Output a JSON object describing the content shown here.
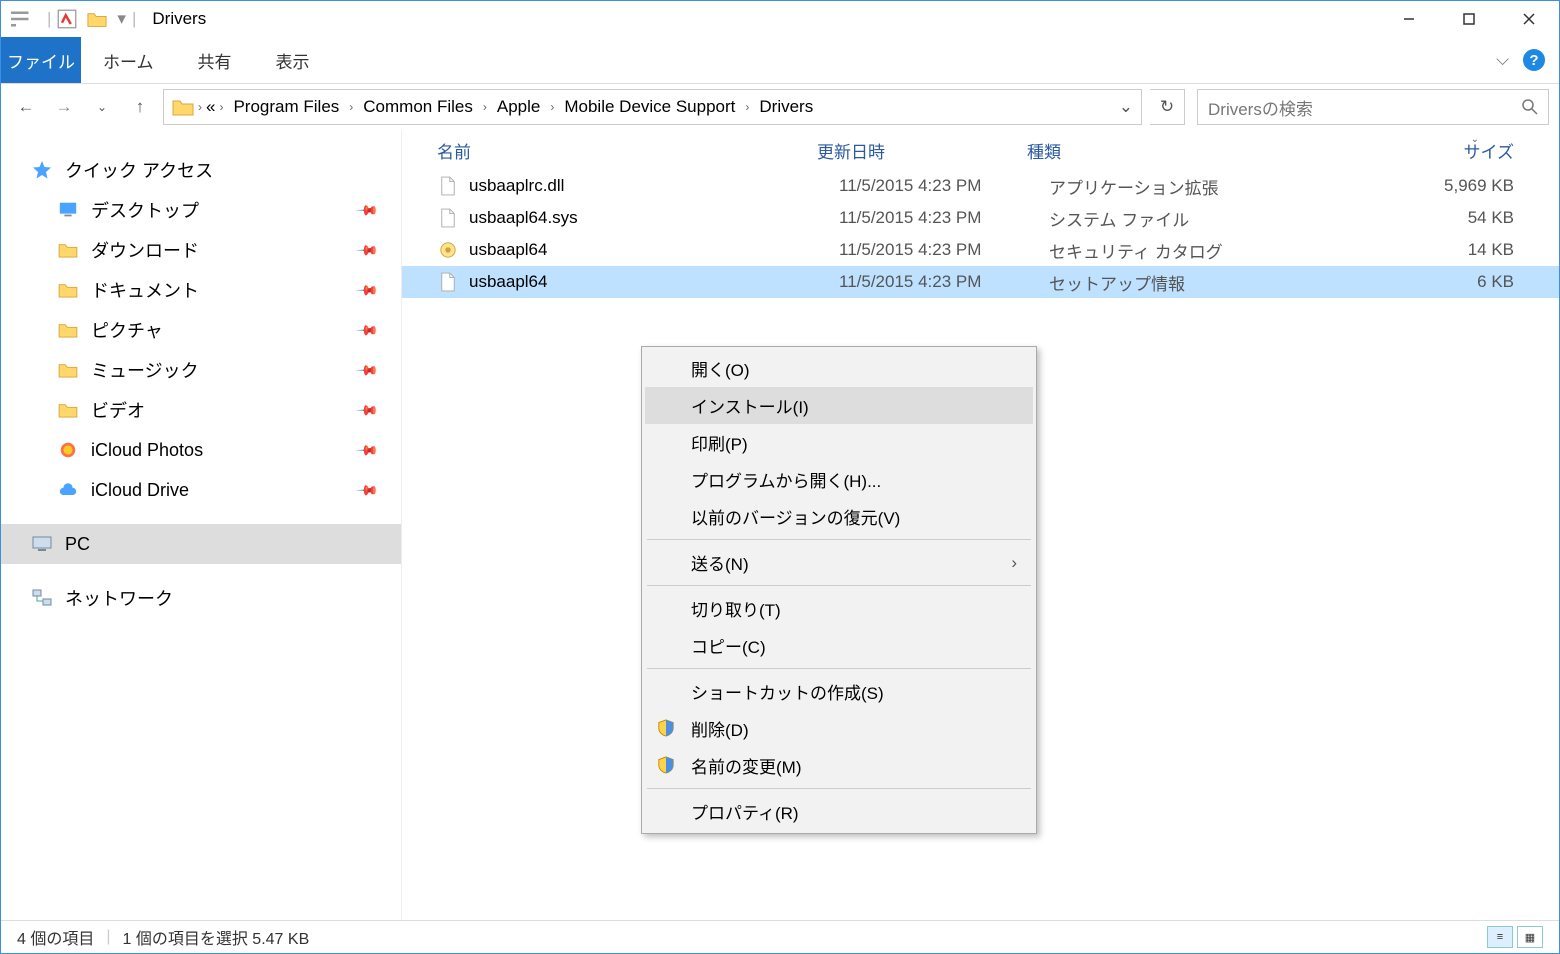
{
  "window": {
    "title": "Drivers"
  },
  "ribbon": {
    "file": "ファイル",
    "tabs": [
      "ホーム",
      "共有",
      "表示"
    ]
  },
  "nav": {
    "crumbs": [
      "Program Files",
      "Common Files",
      "Apple",
      "Mobile Device Support",
      "Drivers"
    ],
    "search_placeholder": "Driversの検索"
  },
  "sidebar": {
    "quick_access": "クイック アクセス",
    "items": [
      {
        "label": "デスクトップ",
        "pin": true,
        "icon": "desktop"
      },
      {
        "label": "ダウンロード",
        "pin": true,
        "icon": "downloads"
      },
      {
        "label": "ドキュメント",
        "pin": true,
        "icon": "documents"
      },
      {
        "label": "ピクチャ",
        "pin": true,
        "icon": "pictures"
      },
      {
        "label": "ミュージック",
        "pin": true,
        "icon": "music"
      },
      {
        "label": "ビデオ",
        "pin": true,
        "icon": "video"
      },
      {
        "label": "iCloud Photos",
        "pin": true,
        "icon": "icloud-photos"
      },
      {
        "label": "iCloud Drive",
        "pin": true,
        "icon": "icloud-drive"
      }
    ],
    "pc": "PC",
    "network": "ネットワーク"
  },
  "columns": {
    "name": "名前",
    "date": "更新日時",
    "type": "種類",
    "size": "サイズ"
  },
  "files": [
    {
      "name": "usbaaplrc.dll",
      "date": "11/5/2015 4:23 PM",
      "type": "アプリケーション拡張",
      "size": "5,969 KB",
      "icon": "dll",
      "selected": false
    },
    {
      "name": "usbaapl64.sys",
      "date": "11/5/2015 4:23 PM",
      "type": "システム ファイル",
      "size": "54 KB",
      "icon": "sys",
      "selected": false
    },
    {
      "name": "usbaapl64",
      "date": "11/5/2015 4:23 PM",
      "type": "セキュリティ カタログ",
      "size": "14 KB",
      "icon": "cat",
      "selected": false
    },
    {
      "name": "usbaapl64",
      "date": "11/5/2015 4:23 PM",
      "type": "セットアップ情報",
      "size": "6 KB",
      "icon": "inf",
      "selected": true
    }
  ],
  "context_menu": {
    "items": [
      {
        "label": "開く(O)"
      },
      {
        "label": "インストール(I)",
        "hover": true
      },
      {
        "label": "印刷(P)"
      },
      {
        "label": "プログラムから開く(H)..."
      },
      {
        "label": "以前のバージョンの復元(V)"
      },
      {
        "sep": true
      },
      {
        "label": "送る(N)",
        "submenu": true
      },
      {
        "sep": true
      },
      {
        "label": "切り取り(T)"
      },
      {
        "label": "コピー(C)"
      },
      {
        "sep": true
      },
      {
        "label": "ショートカットの作成(S)"
      },
      {
        "label": "削除(D)",
        "shield": true
      },
      {
        "label": "名前の変更(M)",
        "shield": true
      },
      {
        "sep": true
      },
      {
        "label": "プロパティ(R)"
      }
    ]
  },
  "status": {
    "items": "4 個の項目",
    "selection": "1 個の項目を選択 5.47 KB"
  }
}
